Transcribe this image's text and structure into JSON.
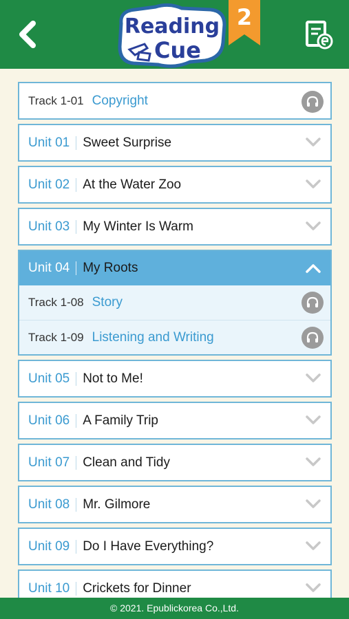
{
  "header": {
    "logo_line1": "Reading",
    "logo_line2": "Cue",
    "level": "2",
    "back_icon": "chevron-left-icon",
    "ebook_icon": "ebook-icon",
    "bg": "#1f8a45"
  },
  "list": {
    "copyright": {
      "track": "Track 1-01",
      "title": "Copyright"
    },
    "units_before": [
      {
        "unit": "Unit 01",
        "title": "Sweet Surprise"
      },
      {
        "unit": "Unit 02",
        "title": "At the Water Zoo"
      },
      {
        "unit": "Unit 03",
        "title": "My Winter Is Warm"
      }
    ],
    "expanded": {
      "unit": "Unit 04",
      "title": "My Roots",
      "tracks": [
        {
          "track": "Track 1-08",
          "title": "Story"
        },
        {
          "track": "Track 1-09",
          "title": "Listening and Writing"
        }
      ]
    },
    "units_after": [
      {
        "unit": "Unit 05",
        "title": "Not to Me!"
      },
      {
        "unit": "Unit 06",
        "title": "A Family Trip"
      },
      {
        "unit": "Unit 07",
        "title": "Clean and Tidy"
      },
      {
        "unit": "Unit 08",
        "title": "Mr. Gilmore"
      },
      {
        "unit": "Unit 09",
        "title": "Do I Have Everything?"
      },
      {
        "unit": "Unit 10",
        "title": "Crickets for Dinner"
      }
    ]
  },
  "footer": {
    "text": "© 2021. Epublickorea Co.,Ltd."
  },
  "colors": {
    "accent": "#5fb0dc",
    "unit_text": "#3a9ad0",
    "footer": "#1f8a45",
    "background": "#f9f5e6"
  }
}
